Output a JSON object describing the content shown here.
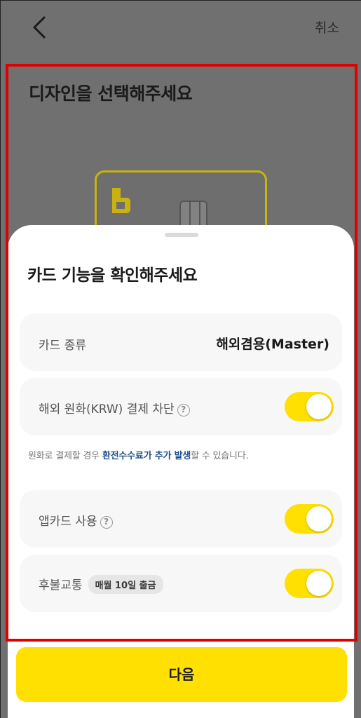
{
  "header": {
    "back_icon": "chevron-left-icon",
    "cancel_label": "취소"
  },
  "background": {
    "title": "디자인을 선택해주세요"
  },
  "sheet": {
    "title": "카드 기능을 확인해주세요",
    "card_type": {
      "label": "카드 종류",
      "value": "해외겸용(Master)"
    },
    "overseas_block": {
      "label": "해외 원화(KRW) 결제 차단",
      "help_icon": "question-circle-icon",
      "enabled": true
    },
    "notice": {
      "prefix": "원화로 결제할 경우 ",
      "emphasis": "환전수수료가 추가 발생",
      "suffix": "할 수 있습니다."
    },
    "app_card": {
      "label": "앱카드 사용",
      "help_icon": "question-circle-icon",
      "enabled": true
    },
    "transit": {
      "label": "후불교통",
      "badge": "매월 10일 출금",
      "enabled": true
    }
  },
  "footer": {
    "next_label": "다음"
  },
  "colors": {
    "accent": "#ffe000",
    "highlight": "#e00000",
    "notice_emphasis": "#1f4e8c"
  }
}
